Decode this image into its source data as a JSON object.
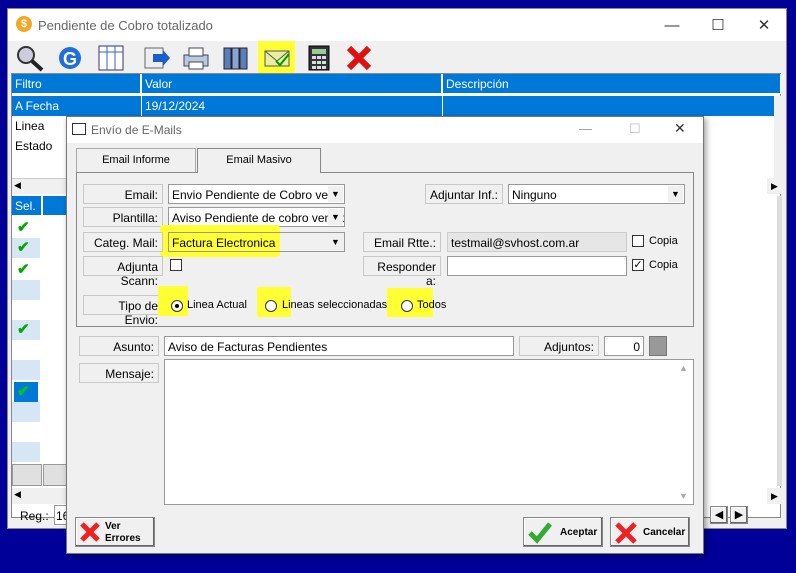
{
  "main_window": {
    "title": "Pendiente de Cobro totalizado",
    "controls": [
      "—",
      "☐",
      "✕"
    ]
  },
  "grid": {
    "columns": [
      "Filtro",
      "Valor",
      "Descripción"
    ],
    "rows": [
      {
        "filtro": "A Fecha",
        "valor": "19/12/2024",
        "descripcion": ""
      },
      {
        "filtro": "Linea",
        "valor": "",
        "descripcion": ""
      },
      {
        "filtro": "Estado",
        "valor": "",
        "descripcion": ""
      }
    ],
    "sel_header": "Sel.",
    "reg_label": "Reg.:",
    "reg_value": "16"
  },
  "dialog": {
    "title": "Envío de E-Mails",
    "tabs": [
      "Email Informe",
      "Email Masivo"
    ],
    "active_tab": 1,
    "fields": {
      "email_label": "Email:",
      "email_value": "Envio Pendiente de Cobro vencid",
      "plantilla_label": "Plantilla:",
      "plantilla_value": "Aviso Pendiente de cobro vencid",
      "categ_label": "Categ. Mail:",
      "categ_value": "Factura Electronica",
      "adjunta_label": "Adjunta Scann:",
      "adjuntar_label": "Adjuntar Inf.:",
      "adjuntar_value": "Ninguno",
      "email_rtte_label": "Email Rtte.:",
      "email_rtte_value": "testmail@svhost.com.ar",
      "responder_label": "Responder a:",
      "responder_value": "",
      "copia1": "Copia",
      "copia2": "Copia",
      "tipo_envio_label": "Tipo de Envio:",
      "radio_linea_actual": "Linea Actual",
      "radio_lineas_sel": "Lineas seleccionadas",
      "radio_todos": "Todos",
      "asunto_label": "Asunto:",
      "asunto_value": "Aviso de Facturas Pendientes",
      "adjuntos_label": "Adjuntos:",
      "adjuntos_value": "0",
      "mensaje_label": "Mensaje:",
      "mensaje_value": ""
    },
    "buttons": {
      "ver_errores": "Ver\nErrores",
      "ver": "Ver",
      "errores": "Errores",
      "aceptar": "Aceptar",
      "cancelar": "Cancelar"
    },
    "controls": [
      "—",
      "☐",
      "✕"
    ]
  },
  "colors": {
    "highlight": "#ffff33",
    "selection": "#0078d7",
    "desktop": "#000099"
  }
}
